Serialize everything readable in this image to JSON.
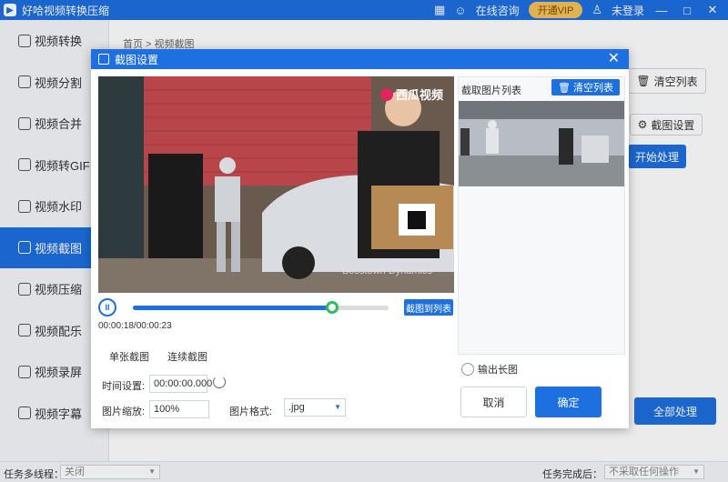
{
  "app": {
    "title": "好哈视频转换压缩"
  },
  "titlebar": {
    "consult_label": "在线咨询",
    "vip_label": "开通VIP",
    "login_label": "未登录",
    "min_symbol": "—",
    "max_symbol": "□",
    "close_symbol": "✕"
  },
  "sidebar": {
    "items": [
      {
        "label": "视频转换"
      },
      {
        "label": "视频分割"
      },
      {
        "label": "视频合并"
      },
      {
        "label": "视频转GIF"
      },
      {
        "label": "视频水印"
      },
      {
        "label": "视频截图"
      },
      {
        "label": "视频压缩"
      },
      {
        "label": "视频配乐"
      },
      {
        "label": "视频录屏"
      },
      {
        "label": "视频字幕"
      }
    ],
    "active_index": 5
  },
  "main": {
    "breadcrumb": "首页 > 视频截图",
    "clear_list_label": "清空列表",
    "settings_label": "截图设置",
    "start_label": "开始处理",
    "process_all_label": "全部处理"
  },
  "bottom": {
    "threads_label": "任务多线程：",
    "threads_value": "关闭",
    "after_label": "任务完成后：",
    "after_value": "不采取任何操作"
  },
  "dialog": {
    "title": "截图设置",
    "close_symbol": "✕",
    "video": {
      "watermark": "西瓜视频",
      "caption": "Bosstown Dynamics"
    },
    "player": {
      "pause_symbol": "II",
      "progress": 0.78,
      "grab_label": "截图到列表",
      "timecode": "00:00:18/00:00:23"
    },
    "tabs": [
      "单张截图",
      "连续截图"
    ],
    "time_label": "时间设置:",
    "time_value": "00:00:00.000",
    "scale_label": "图片缩放:",
    "scale_value": "100%",
    "format_label": "图片格式:",
    "format_value": ".jpg",
    "list_title": "截取图片列表",
    "clear_list_label": "清空列表",
    "long_image_label": "输出长图",
    "cancel_label": "取消",
    "ok_label": "确定"
  },
  "colors": {
    "primary": "#1e6fe0",
    "progress_knob": "#2fbf5a",
    "vip": "#f5c25a"
  }
}
